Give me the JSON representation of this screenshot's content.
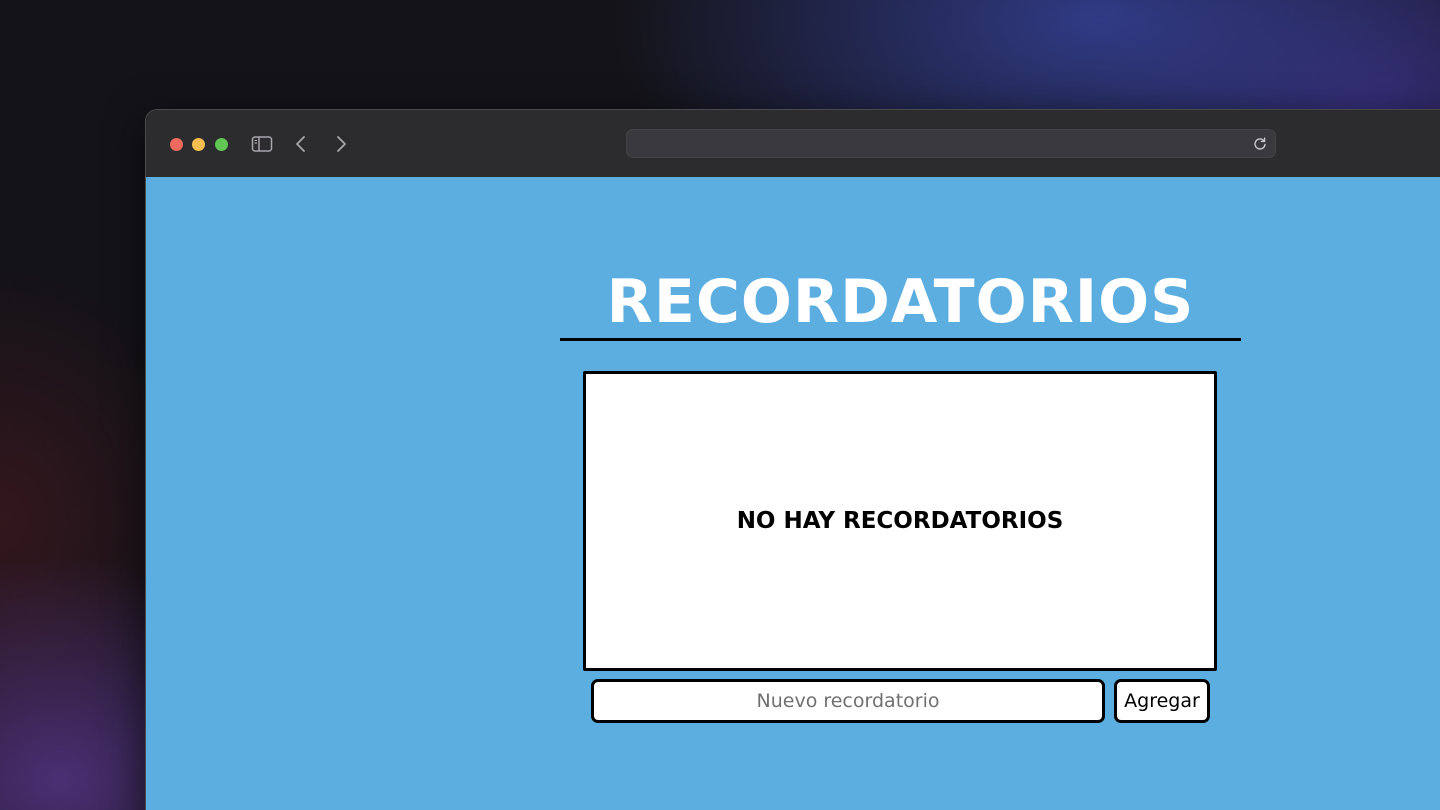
{
  "browser": {
    "address_bar": {
      "value": ""
    }
  },
  "page": {
    "title": "RECORDATORIOS",
    "empty_state": "NO HAY RECORDATORIOS",
    "input": {
      "placeholder": "Nuevo recordatorio",
      "value": ""
    },
    "add_button_label": "Agregar"
  },
  "colors": {
    "page_background": "#5caee1",
    "title_text": "#ffffff",
    "panel_background": "#ffffff",
    "border": "#000000",
    "titlebar": "#2c2b2e",
    "traffic_close": "#ee6a5e",
    "traffic_minimize": "#f5be4f",
    "traffic_maximize": "#61c454"
  },
  "icons": [
    "sidebar-icon",
    "chevron-left-icon",
    "chevron-right-icon",
    "reload-icon"
  ]
}
